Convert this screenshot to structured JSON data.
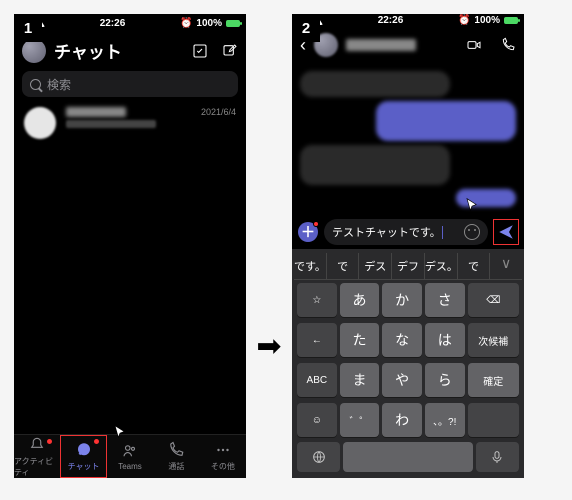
{
  "steps": [
    "1",
    "2"
  ],
  "status": {
    "time": "22:26",
    "battery_text": "100%",
    "alarm": "⏰"
  },
  "screen1": {
    "title": "チャット",
    "search_placeholder": "検索",
    "chat_item": {
      "date": "2021/6/4"
    },
    "nav": {
      "activity": "アクティビティ",
      "chat": "チャット",
      "teams": "Teams",
      "calls": "通話",
      "more": "その他"
    }
  },
  "screen2": {
    "compose_text": "テストチャットです。",
    "candidates": [
      "です。",
      "で",
      "デス",
      "デフ",
      "デス。",
      "で"
    ],
    "candidate_expand": "∨",
    "keys": {
      "r1": [
        "☆",
        "あ",
        "か",
        "さ"
      ],
      "r1_tail": "⌫",
      "r2l": "←",
      "r2": [
        "た",
        "な",
        "は"
      ],
      "r2r": "次候補",
      "r3l": "ABC",
      "r3": [
        "ま",
        "や",
        "ら"
      ],
      "r3r": "確定",
      "r4l": "☺",
      "r4": [
        "゛゜",
        "わ",
        "、。?!"
      ]
    }
  }
}
